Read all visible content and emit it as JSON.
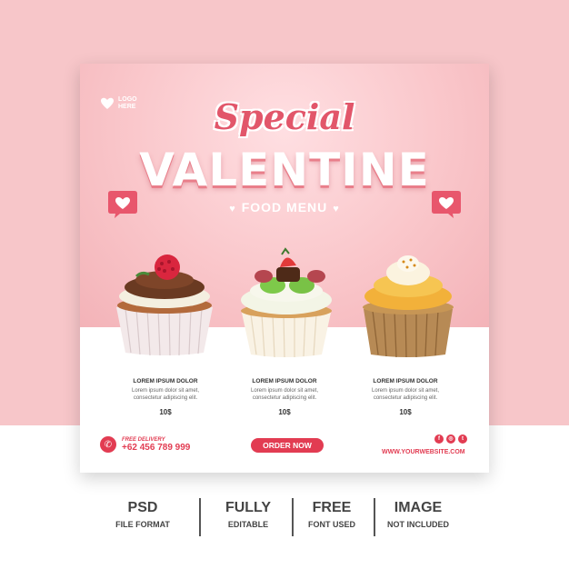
{
  "logo": {
    "text": "LOGO HERE"
  },
  "headline": {
    "script": "Special",
    "title": "VALENTINE",
    "subtitle": "FOOD MENU"
  },
  "products": [
    {
      "title": "LOREM IPSUM DOLOR",
      "body_line1": "Lorem ipsum dolor sit amet,",
      "body_line2": "consectetur adipiscing elit.",
      "price": "10$"
    },
    {
      "title": "LOREM IPSUM DOLOR",
      "body_line1": "Lorem ipsum dolor sit amet,",
      "body_line2": "consectetur adipiscing elit.",
      "price": "10$"
    },
    {
      "title": "LOREM IPSUM DOLOR",
      "body_line1": "Lorem ipsum dolor sit amet,",
      "body_line2": "consectetur adipiscing elit.",
      "price": "10$"
    }
  ],
  "contact": {
    "label": "FREE DELIVERY",
    "phone": "+62 456 789 999",
    "icon": "phone-icon"
  },
  "order_button": "ORDER NOW",
  "social": {
    "icons": [
      "facebook-icon",
      "instagram-icon",
      "twitter-icon"
    ],
    "glyphs": [
      "f",
      "◎",
      "t"
    ]
  },
  "website": "WWW.YOURWEBSITE.COM",
  "features": [
    {
      "title": "PSD",
      "sub": "FILE FORMAT"
    },
    {
      "title": "FULLY",
      "sub": "EDITABLE"
    },
    {
      "title": "FREE",
      "sub": "FONT USED"
    },
    {
      "title": "IMAGE",
      "sub": "NOT INCLUDED"
    }
  ],
  "colors": {
    "accent": "#e23c52",
    "pink_bg": "#f7c6c9",
    "title_red": "#e2566a"
  }
}
